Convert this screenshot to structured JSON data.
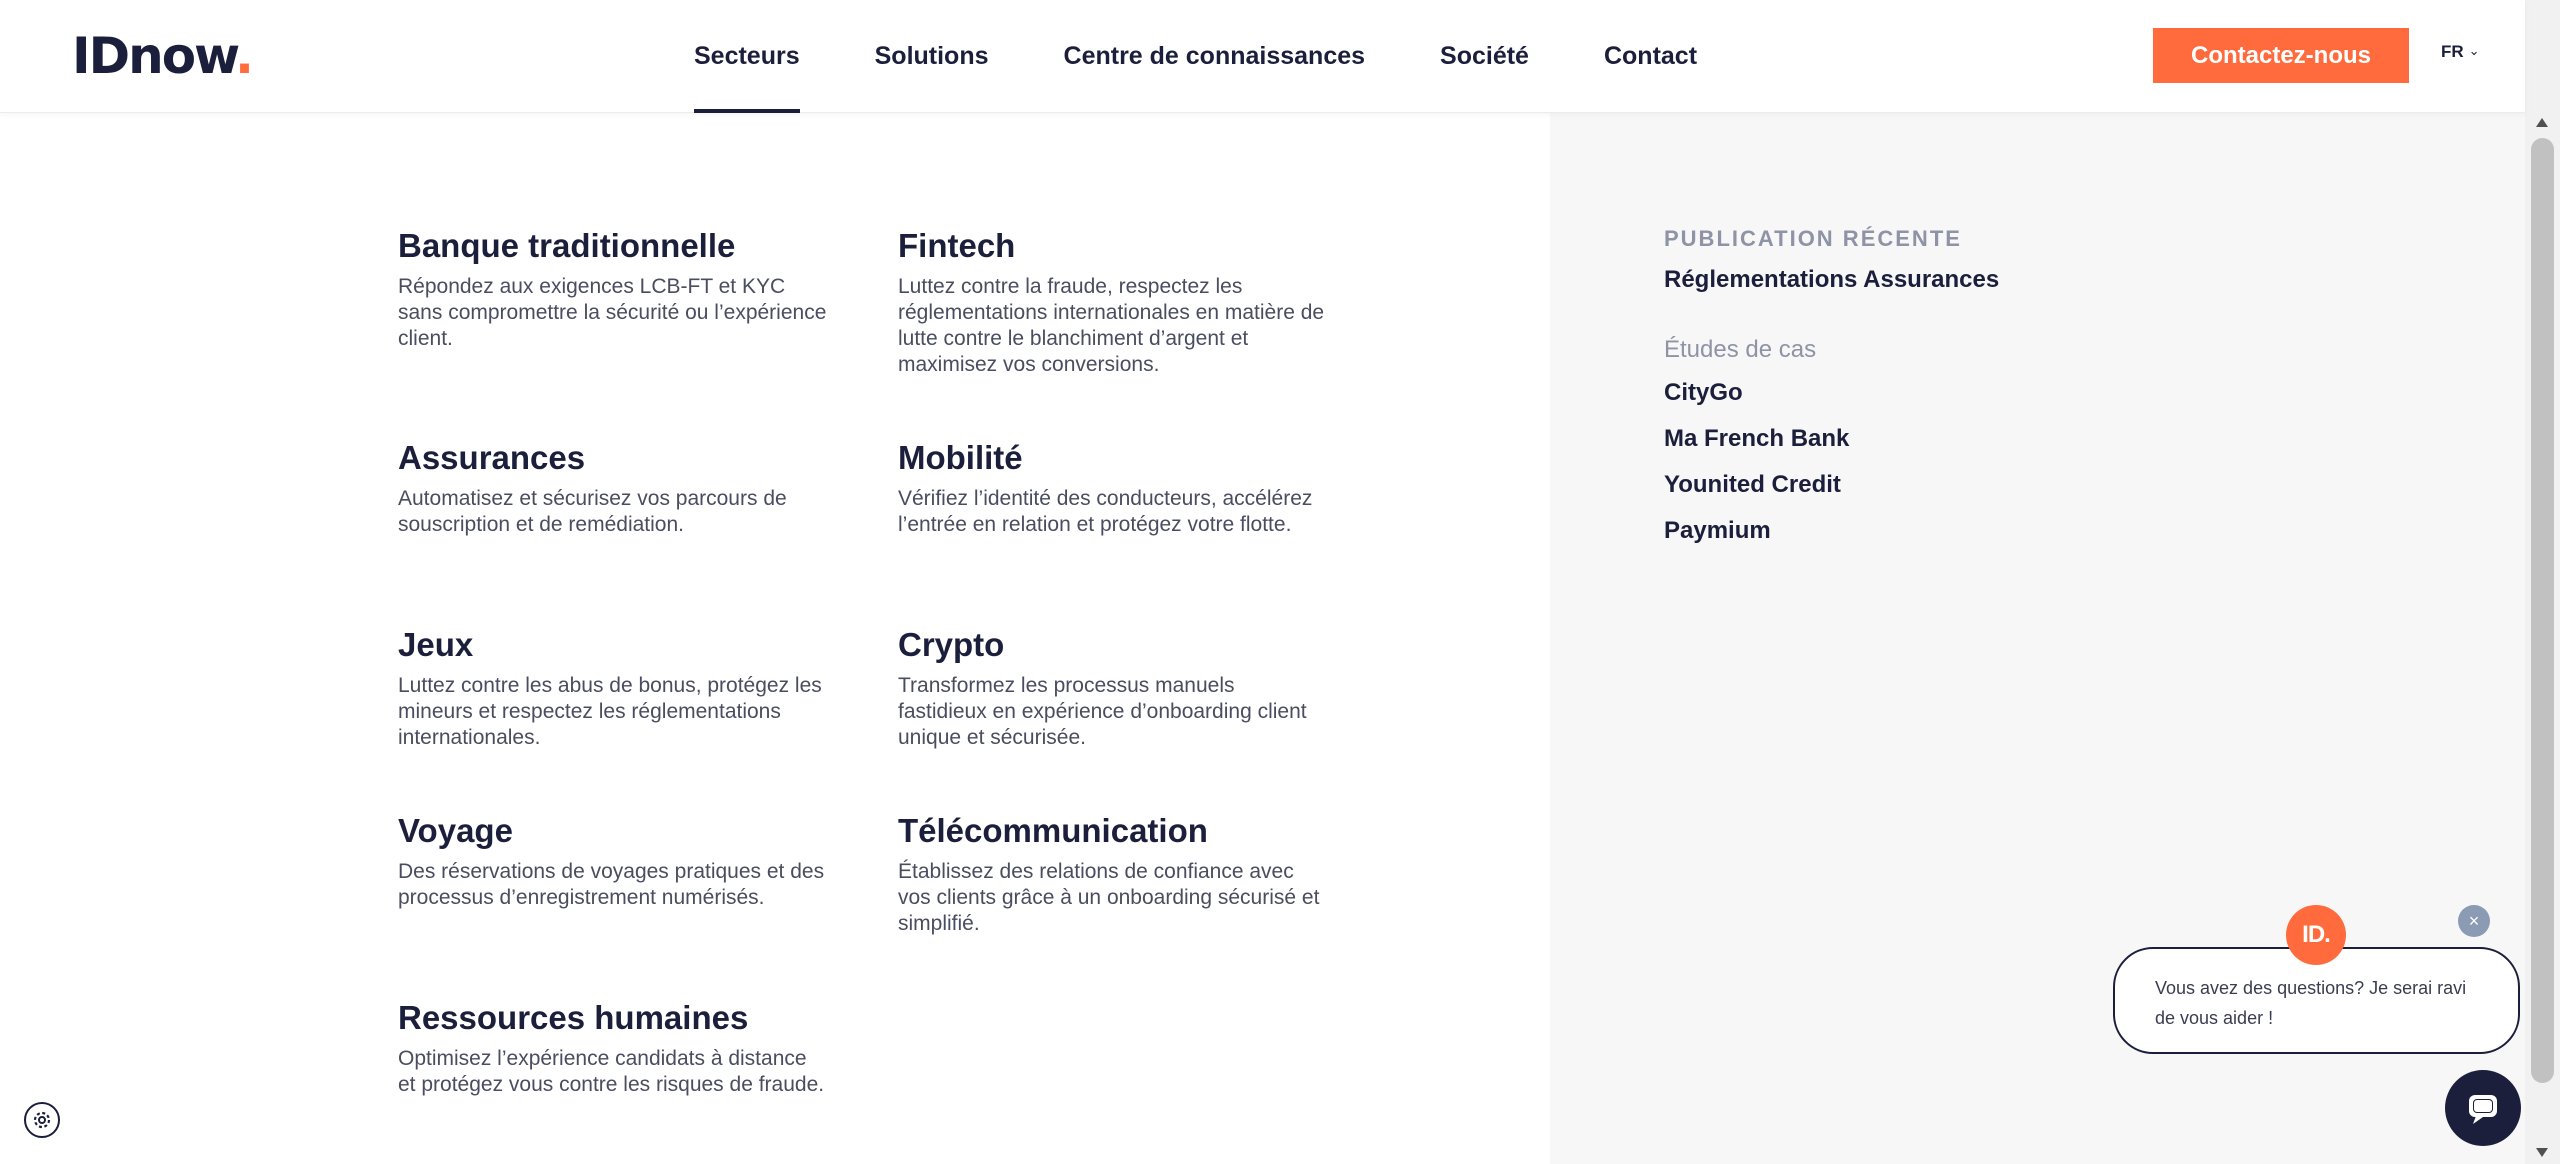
{
  "header": {
    "logo_text": "IDnow",
    "logo_dot": ".",
    "nav": [
      {
        "label": "Secteurs",
        "active": true
      },
      {
        "label": "Solutions",
        "active": false
      },
      {
        "label": "Centre de connaissances",
        "active": false
      },
      {
        "label": "Société",
        "active": false
      },
      {
        "label": "Contact",
        "active": false
      }
    ],
    "cta_label": "Contactez-nous",
    "language": "FR"
  },
  "sectors": [
    {
      "title": "Banque traditionnelle",
      "desc": "Répondez aux exigences LCB-FT et KYC sans compromettre la sécurité ou l’expérience client."
    },
    {
      "title": "Fintech",
      "desc": "Luttez contre la fraude, respectez les réglementations internationales en matière de lutte contre le blanchiment d’argent et maximisez vos conversions."
    },
    {
      "title": "Assurances",
      "desc": "Automatisez et sécurisez vos parcours de souscription et de remédiation."
    },
    {
      "title": "Mobilité",
      "desc": "Vérifiez l’identité des conducteurs, accélérez l’entrée en relation et protégez votre flotte."
    },
    {
      "title": "Jeux",
      "desc": "Luttez contre les abus de bonus, protégez les mineurs et respectez les réglementations internationales."
    },
    {
      "title": "Crypto",
      "desc": "Transformez les processus manuels fastidieux en expérience d’onboarding client unique et sécurisée."
    },
    {
      "title": "Voyage",
      "desc": "Des réservations de voyages pratiques et des processus d’enregistrement numérisés."
    },
    {
      "title": "Télécommunication",
      "desc": "Établissez des relations de confiance avec vos clients grâce à un onboarding sécurisé et simplifié."
    },
    {
      "title": "Ressources humaines",
      "desc": "Optimisez l’expérience candidats à distance et protégez vous contre les risques de fraude."
    }
  ],
  "panel": {
    "recent_heading": "PUBLICATION RÉCENTE",
    "recent_link": "Réglementations Assurances",
    "cases_heading": "Études de cas",
    "cases": [
      "CityGo",
      "Ma French Bank",
      "Younited Credit",
      "Paymium"
    ]
  },
  "chat": {
    "avatar_text": "ID.",
    "message": "Vous avez des questions? Je serai ravi de vous aider !",
    "close_symbol": "×"
  },
  "colors": {
    "brand_orange": "#ff6b3d",
    "navy": "#1b1f3b",
    "muted": "#8e93a6",
    "panel_bg": "#f7f7f7"
  }
}
